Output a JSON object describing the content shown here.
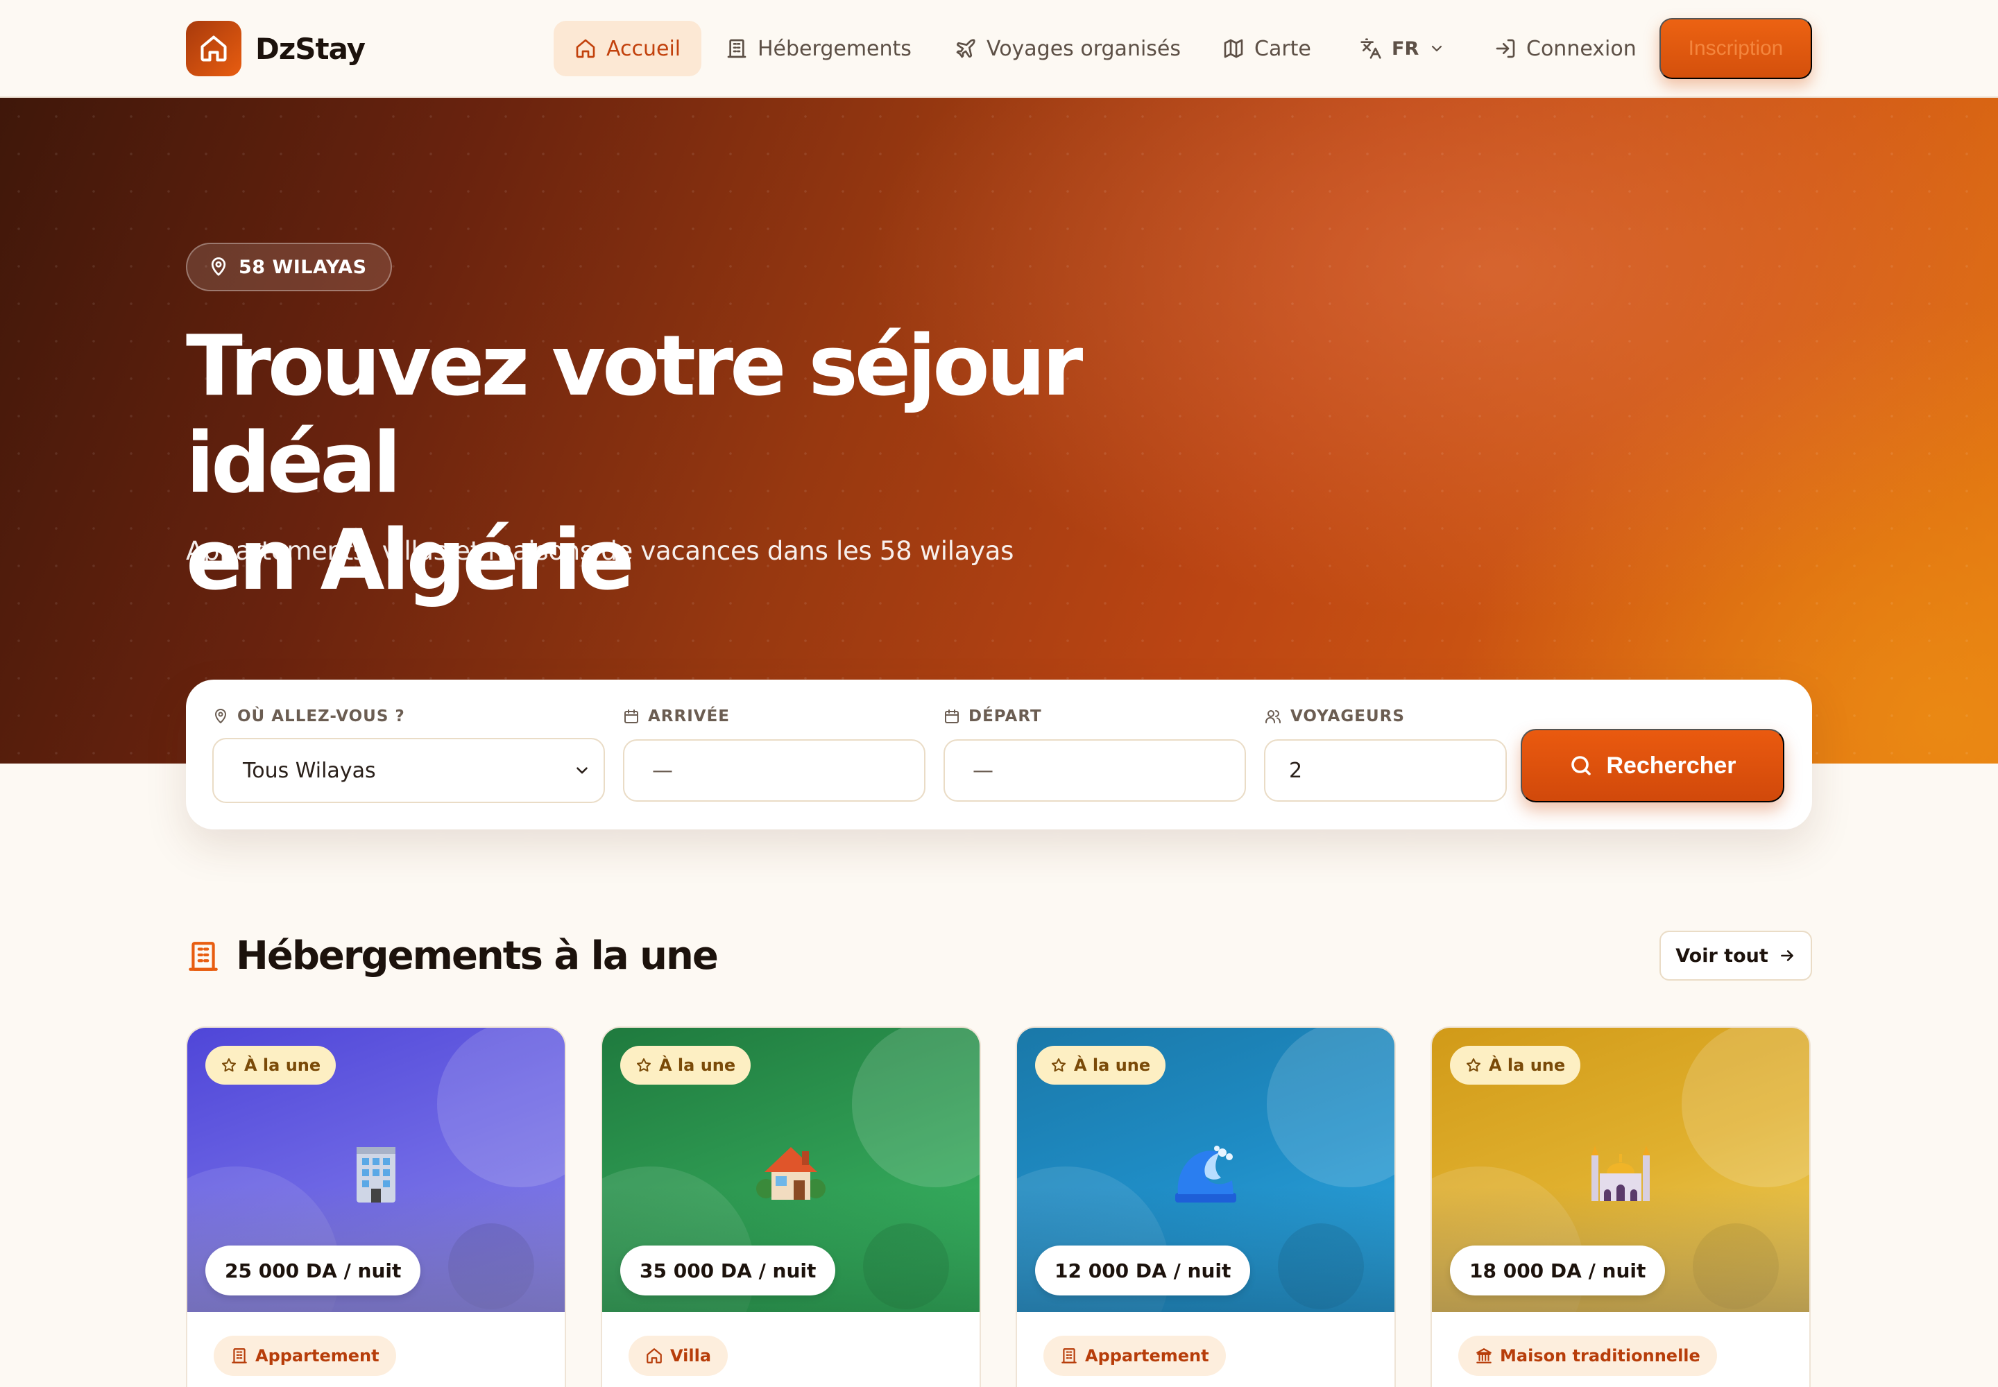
{
  "brand": {
    "name": "DzStay"
  },
  "nav": {
    "items": [
      {
        "label": "Accueil",
        "icon": "home-icon",
        "active": true
      },
      {
        "label": "Hébergements",
        "icon": "building-icon"
      },
      {
        "label": "Voyages organisés",
        "icon": "plane-icon"
      },
      {
        "label": "Carte",
        "icon": "map-icon"
      }
    ],
    "language": "FR",
    "login": "Connexion",
    "signup": "Inscription"
  },
  "hero": {
    "badge": "58 WILAYAS",
    "title_line1": "Trouvez votre séjour idéal",
    "title_line2": "en Algérie",
    "subtitle": "Appartements, villas et maisons de vacances dans les 58 wilayas"
  },
  "search": {
    "destination_label": "OÙ ALLEZ-VOUS ?",
    "destination_value": "Tous Wilayas",
    "arrival_label": "ARRIVÉE",
    "arrival_value": "—",
    "departure_label": "DÉPART",
    "departure_value": "—",
    "guests_label": "VOYAGEURS",
    "guests_value": "2",
    "button": "Rechercher"
  },
  "featured": {
    "title": "Hébergements à la une",
    "see_all": "Voir tout",
    "cards": [
      {
        "badge": "À la une",
        "price": "25 000 DA / nuit",
        "type": "Appartement",
        "emoji": "office-building-emoji",
        "type_icon": "building-icon"
      },
      {
        "badge": "À la une",
        "price": "35 000 DA / nuit",
        "type": "Villa",
        "emoji": "house-emoji",
        "type_icon": "home-icon"
      },
      {
        "badge": "À la une",
        "price": "12 000 DA / nuit",
        "type": "Appartement",
        "emoji": "wave-emoji",
        "type_icon": "building-icon"
      },
      {
        "badge": "À la une",
        "price": "18 000 DA / nuit",
        "type": "Maison traditionnelle",
        "emoji": "mosque-emoji",
        "type_icon": "landmark-icon"
      }
    ]
  },
  "colors": {
    "accent": "#e85d10",
    "accent_dark": "#c2410c",
    "page_bg": "#fdf9f3",
    "card1": "#6a63e0",
    "card2": "#2e9a52",
    "card3": "#1f8dc6",
    "card4": "#e0b02e"
  }
}
